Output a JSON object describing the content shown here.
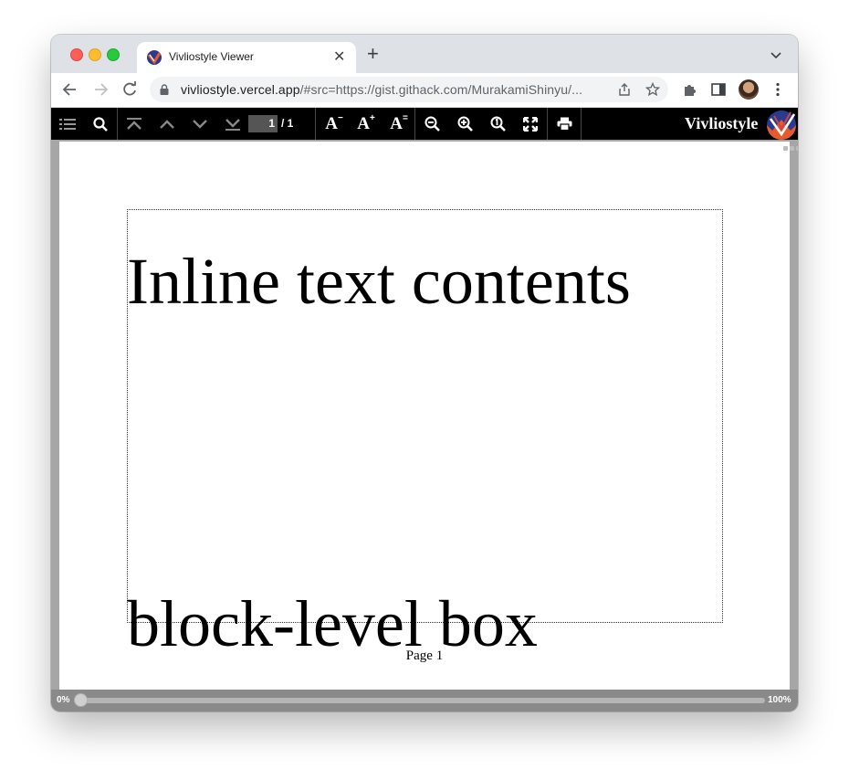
{
  "browser": {
    "tab_title": "Vivliostyle Viewer",
    "url_host": "vivliostyle.vercel.app",
    "url_rest": "/#src=https://gist.githack.com/MurakamiShinyu/...",
    "icons": [
      "back-icon",
      "forward-icon",
      "reload-icon",
      "lock-icon",
      "share-icon",
      "star-icon",
      "extensions-icon",
      "side-panel-icon",
      "profile-avatar",
      "more-icon"
    ]
  },
  "viewer_toolbar": {
    "page_current": "1",
    "page_total": "/ 1",
    "font_decrease": "A",
    "font_decrease_sup": "−",
    "font_increase": "A",
    "font_increase_sup": "+",
    "font_reset": "A",
    "font_reset_sup": "=",
    "brand": "Vivliostyle"
  },
  "document": {
    "inline_text": "Inline text contents",
    "block_text": "block-level box",
    "page_label": "Page 1"
  },
  "progress": {
    "start_label": "0%",
    "end_label": "100%",
    "value": 0
  }
}
